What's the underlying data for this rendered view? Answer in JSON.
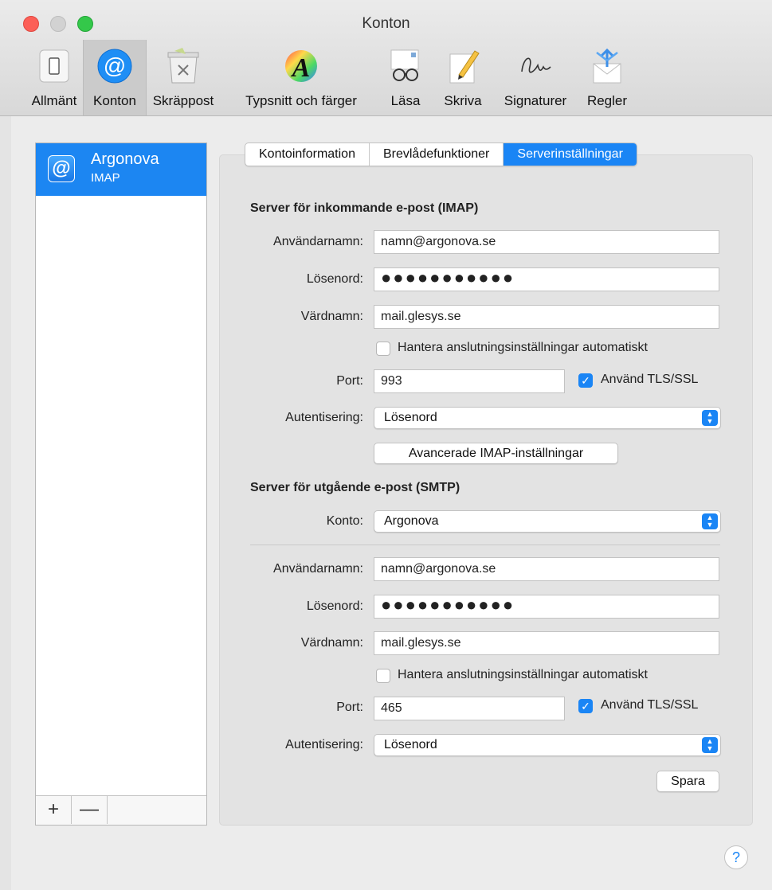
{
  "window": {
    "title": "Konton"
  },
  "toolbar": {
    "items": [
      {
        "label": "Allmänt",
        "icon": "switch-icon"
      },
      {
        "label": "Konton",
        "icon": "at-sign-icon",
        "selected": true
      },
      {
        "label": "Skräppost",
        "icon": "junk-bin-icon"
      },
      {
        "label": "Typsnitt och färger",
        "icon": "font-color-icon"
      },
      {
        "label": "Läsa",
        "icon": "reading-glasses-icon"
      },
      {
        "label": "Skriva",
        "icon": "pencil-paper-icon"
      },
      {
        "label": "Signaturer",
        "icon": "signature-icon"
      },
      {
        "label": "Regler",
        "icon": "rules-envelope-icon"
      }
    ]
  },
  "sidebar": {
    "account": {
      "icon_glyph": "@",
      "name": "Argonova",
      "type": "IMAP"
    },
    "add_glyph": "+",
    "remove_glyph": "—"
  },
  "tabs": {
    "items": [
      "Kontoinformation",
      "Brevlådefunktioner",
      "Serverinställningar"
    ],
    "active": "Serverinställningar"
  },
  "incoming": {
    "title": "Server för inkommande e-post (IMAP)",
    "username_label": "Användarnamn:",
    "username": "namn@argonova.se",
    "password_label": "Lösenord:",
    "password": "●●●●●●●●●●●",
    "host_label": "Värdnamn:",
    "host": "mail.glesys.se",
    "auto_label": "Hantera anslutningsinställningar automatiskt",
    "auto_checked": false,
    "port_label": "Port:",
    "port": "993",
    "tls_label": "Använd TLS/SSL",
    "tls_checked": true,
    "auth_label": "Autentisering:",
    "auth": "Lösenord",
    "advanced_button": "Avancerade IMAP-inställningar"
  },
  "outgoing": {
    "title": "Server för utgående e-post (SMTP)",
    "account_label": "Konto:",
    "account": "Argonova",
    "username_label": "Användarnamn:",
    "username": "namn@argonova.se",
    "password_label": "Lösenord:",
    "password": "●●●●●●●●●●●",
    "host_label": "Värdnamn:",
    "host": "mail.glesys.se",
    "auto_label": "Hantera anslutningsinställningar automatiskt",
    "auto_checked": false,
    "port_label": "Port:",
    "port": "465",
    "tls_label": "Använd TLS/SSL",
    "tls_checked": true,
    "auth_label": "Autentisering:",
    "auth": "Lösenord",
    "save_button": "Spara"
  },
  "help": {
    "glyph": "?"
  },
  "colors": {
    "accent": "#1a85f5",
    "close": "#fc5f57",
    "zoom": "#34c84a"
  }
}
